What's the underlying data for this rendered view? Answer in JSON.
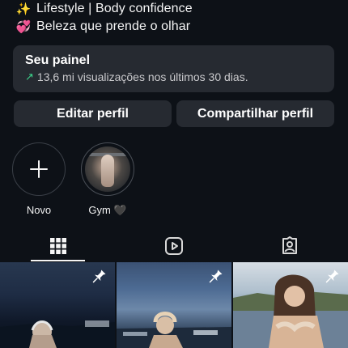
{
  "bio": {
    "line1_emoji": "✨",
    "line1": "Lifestyle | Body confidence",
    "line2_emoji": "💞",
    "line2": "Beleza que prende o olhar"
  },
  "dashboard": {
    "title": "Seu painel",
    "arrow": "↗",
    "subtitle": "13,6 mi visualizações nos últimos 30 dias."
  },
  "buttons": {
    "edit_profile": "Editar perfil",
    "share_profile": "Compartilhar perfil"
  },
  "highlights": [
    {
      "label": "Novo",
      "icon": "plus-icon"
    },
    {
      "label": "Gym 🖤",
      "icon": "highlight-cover"
    }
  ],
  "tabs": [
    {
      "icon": "grid-icon",
      "selected": true
    },
    {
      "icon": "reels-icon",
      "selected": false
    },
    {
      "icon": "tagged-icon",
      "selected": false
    }
  ],
  "posts": [
    {
      "pinned": true,
      "icon": "pin-icon"
    },
    {
      "pinned": true,
      "icon": "pin-icon"
    },
    {
      "pinned": true,
      "icon": "pin-icon"
    }
  ],
  "colors": {
    "background": "#0d1117",
    "card": "#262a31",
    "trend_green": "#3dd68c"
  }
}
